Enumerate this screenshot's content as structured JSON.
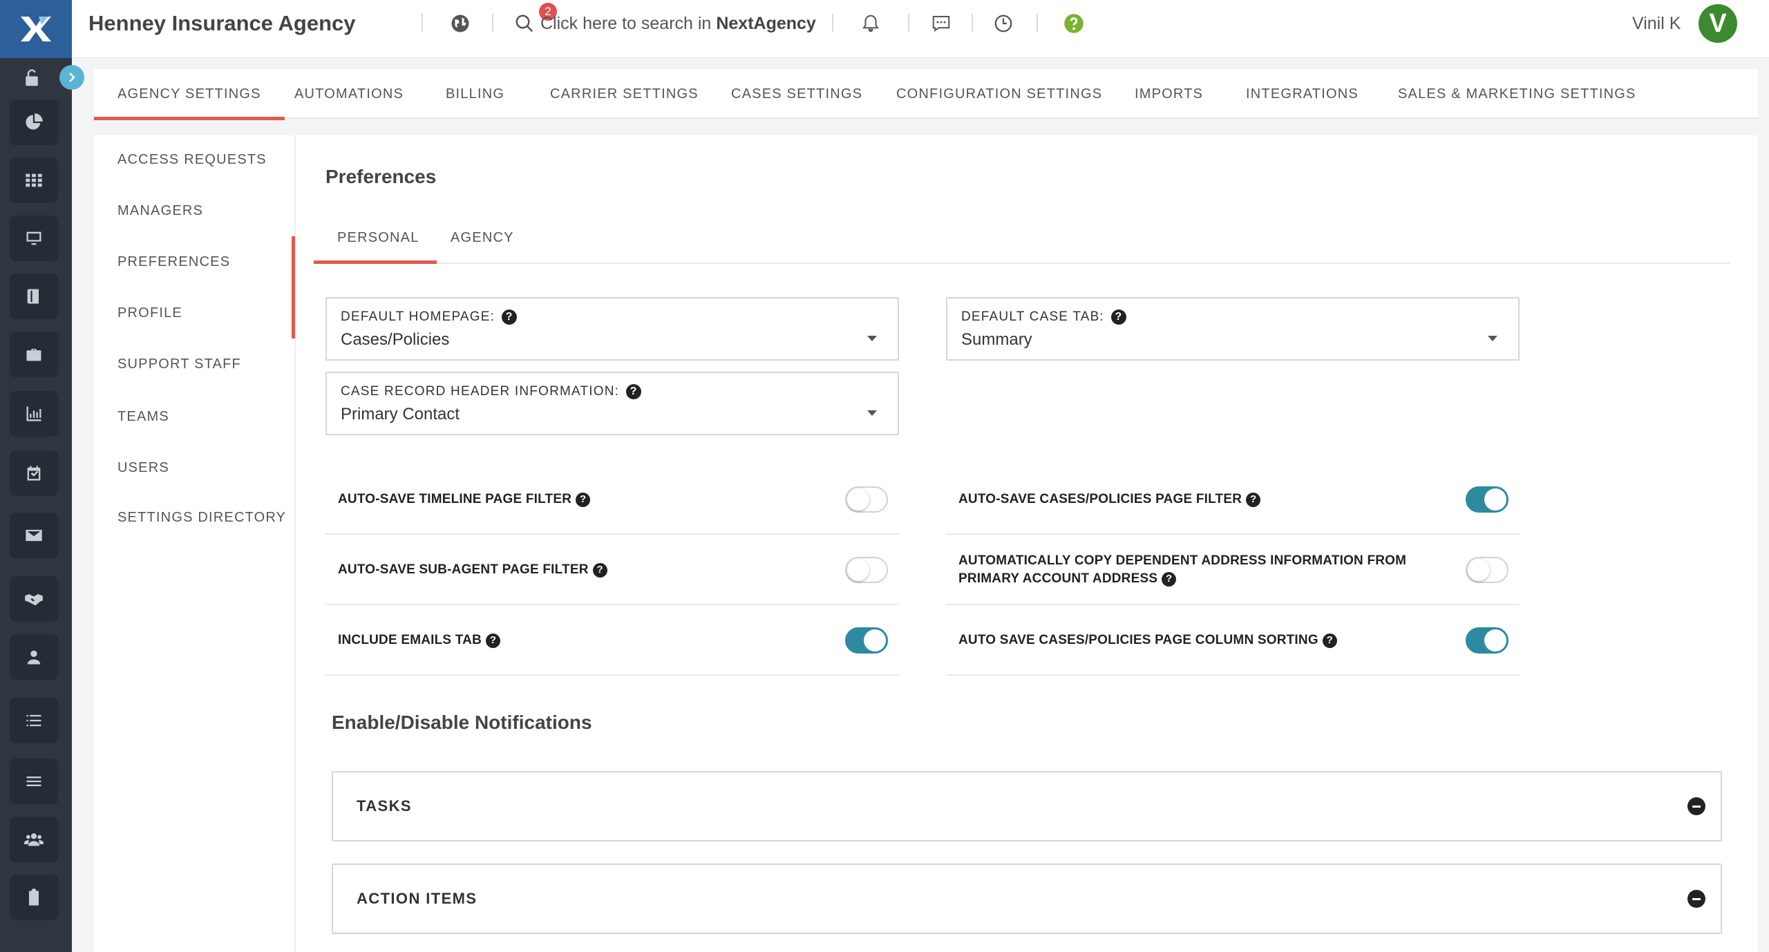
{
  "header": {
    "agency_name": "Henney Insurance Agency",
    "notifications_badge": "2",
    "search_prefix": "Click here to search in",
    "search_brand": "NextAgency",
    "user_name": "Vinil K",
    "avatar_initial": "V",
    "help_icon_color": "#7ab32e"
  },
  "tabs": [
    {
      "label": "AGENCY SETTINGS",
      "active": true
    },
    {
      "label": "AUTOMATIONS"
    },
    {
      "label": "BILLING"
    },
    {
      "label": "CARRIER SETTINGS"
    },
    {
      "label": "CASES SETTINGS"
    },
    {
      "label": "CONFIGURATION SETTINGS"
    },
    {
      "label": "IMPORTS"
    },
    {
      "label": "INTEGRATIONS"
    },
    {
      "label": "SALES & MARKETING SETTINGS"
    }
  ],
  "subnav": [
    {
      "label": "ACCESS REQUESTS"
    },
    {
      "label": "MANAGERS"
    },
    {
      "label": "PREFERENCES",
      "active": true
    },
    {
      "label": "PROFILE"
    },
    {
      "label": "SUPPORT STAFF"
    },
    {
      "label": "TEAMS"
    },
    {
      "label": "USERS"
    },
    {
      "label": "SETTINGS DIRECTORY"
    }
  ],
  "preferences": {
    "title": "Preferences",
    "tabs": [
      {
        "label": "PERSONAL",
        "active": true
      },
      {
        "label": "AGENCY"
      }
    ],
    "selects": {
      "default_homepage": {
        "label": "DEFAULT HOMEPAGE:",
        "value": "Cases/Policies"
      },
      "default_case_tab": {
        "label": "DEFAULT CASE TAB:",
        "value": "Summary"
      },
      "case_record_header": {
        "label": "CASE RECORD HEADER INFORMATION:",
        "value": "Primary Contact"
      }
    },
    "toggles": {
      "timeline_filter": {
        "label": "AUTO-SAVE TIMELINE PAGE FILTER",
        "on": false
      },
      "cases_filter": {
        "label": "AUTO-SAVE CASES/POLICIES PAGE FILTER",
        "on": true
      },
      "subagent_filter": {
        "label": "AUTO-SAVE SUB-AGENT PAGE FILTER",
        "on": false
      },
      "copy_address": {
        "label": "AUTOMATICALLY COPY DEPENDENT ADDRESS INFORMATION FROM PRIMARY ACCOUNT ADDRESS",
        "on": false
      },
      "emails_tab": {
        "label": "INCLUDE EMAILS TAB",
        "on": true
      },
      "column_sorting": {
        "label": "AUTO SAVE CASES/POLICIES PAGE COLUMN SORTING",
        "on": true
      }
    },
    "help_glyph": "?"
  },
  "notifications": {
    "title": "Enable/Disable Notifications",
    "panels": [
      {
        "label": "TASKS"
      },
      {
        "label": "ACTION ITEMS"
      }
    ]
  },
  "colors": {
    "accent_red": "#e05a4e",
    "toggle_on": "#2e8aa0",
    "rail_bg": "#2f3640",
    "logo_bg": "#2d5f9a"
  }
}
